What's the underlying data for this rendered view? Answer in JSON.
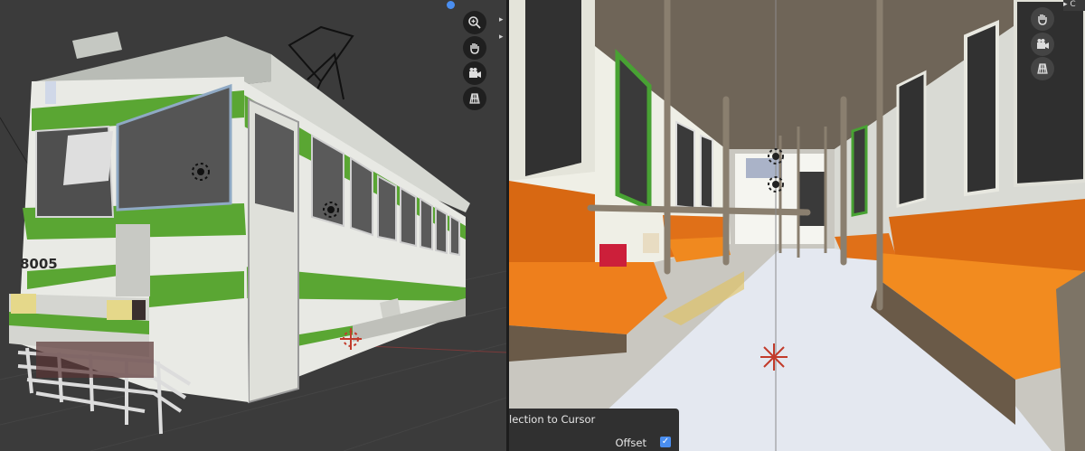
{
  "left_viewport": {
    "tram_number": "8005",
    "nav_icons": [
      "zoom-icon",
      "hand-pan-icon",
      "camera-icon",
      "grid-view-icon"
    ]
  },
  "right_viewport": {
    "nav_icons": [
      "hand-pan-icon",
      "camera-icon",
      "grid-view-icon"
    ],
    "header_tab": "▸ C"
  },
  "operator_panel": {
    "title": "lection to Cursor",
    "option_label": "Offset",
    "option_checked": true,
    "check_mark": "✓"
  },
  "colors": {
    "accent": "#4a8ef0",
    "tram_green": "#5aa633",
    "seat_orange": "#e8720c"
  }
}
